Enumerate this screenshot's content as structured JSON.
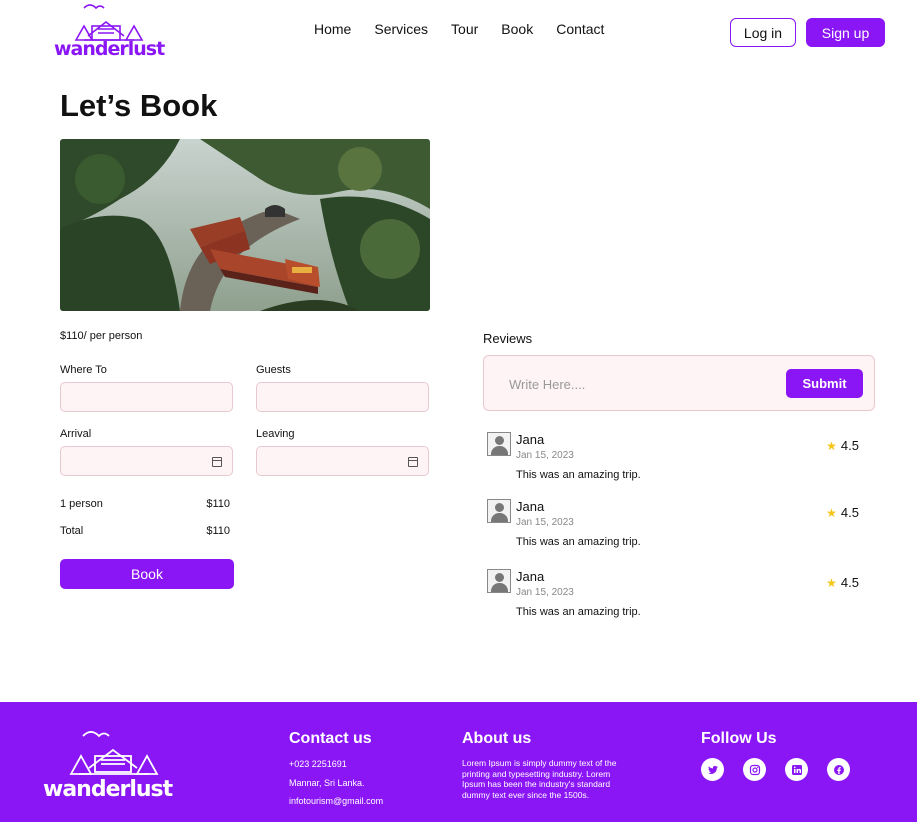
{
  "brand": {
    "name": "wanderlust",
    "color": "#8b16f5"
  },
  "nav": {
    "items": [
      "Home",
      "Services",
      "Tour",
      "Book",
      "Contact"
    ],
    "login_label": "Log in",
    "signup_label": "Sign up"
  },
  "page": {
    "title": "Let’s Book",
    "price": "$110/ per person"
  },
  "form": {
    "where_to_label": "Where To",
    "guests_label": "Guests",
    "arrival_label": "Arrival",
    "leaving_label": "Leaving",
    "person_label": "1 person",
    "person_value": "$110",
    "total_label": "Total",
    "total_value": "$110",
    "book_label": "Book"
  },
  "reviews": {
    "title": "Reviews",
    "placeholder": "Write Here....",
    "submit_label": "Submit",
    "items": [
      {
        "name": "Jana",
        "date": "Jan 15, 2023",
        "text": "This was an amazing trip.",
        "rating": "4.5"
      },
      {
        "name": "Jana",
        "date": "Jan 15, 2023",
        "text": "This was an amazing trip.",
        "rating": "4.5"
      },
      {
        "name": "Jana",
        "date": "Jan 15, 2023",
        "text": "This was an amazing trip.",
        "rating": "4.5"
      }
    ]
  },
  "footer": {
    "contact_title": "Contact us",
    "phone": "+023 2251691",
    "address": "Mannar, Sri Lanka.",
    "email": "infotourism@gmail.com",
    "about_title": "About us",
    "about_text": "Lorem Ipsum is simply dummy text of the printing and typesetting industry. Lorem Ipsum has been the industry's standard dummy text ever since the 1500s.",
    "follow_title": "Follow Us",
    "socials": [
      "twitter-icon",
      "instagram-icon",
      "linkedin-icon",
      "facebook-icon"
    ]
  }
}
